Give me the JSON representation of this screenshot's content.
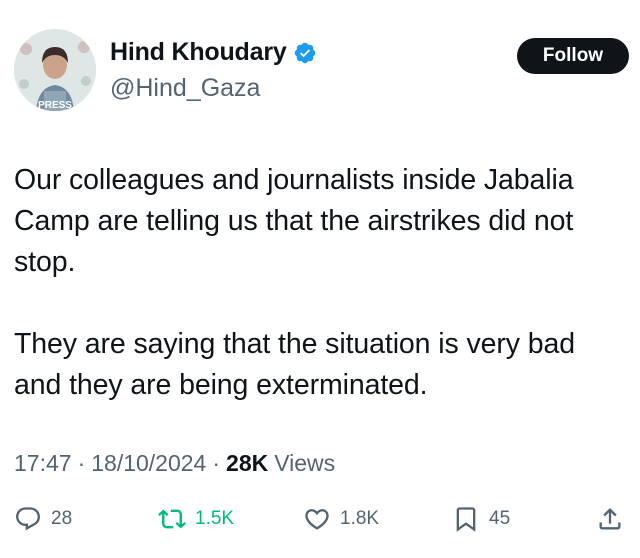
{
  "author": {
    "display_name": "Hind Khoudary",
    "handle": "@Hind_Gaza",
    "verified": true,
    "avatar_text": "PRESS"
  },
  "follow_label": "Follow",
  "tweet": {
    "paragraphs": [
      "Our colleagues and journalists inside Jabalia Camp are telling us that the airstrikes did not stop.",
      "They are saying that the situation is very bad and they are being exterminated."
    ]
  },
  "meta": {
    "time": "17:47",
    "date": "18/10/2024",
    "views_count": "28K",
    "views_label": "Views",
    "separator": "·"
  },
  "actions": {
    "replies": "28",
    "retweets": "1.5K",
    "likes": "1.8K",
    "bookmarks": "45"
  },
  "colors": {
    "verified": "#1d9bf0",
    "retweet_active": "#00ba7c",
    "muted": "#536471",
    "text": "#0f1419"
  },
  "icons": [
    "verified-badge-icon",
    "reply-icon",
    "retweet-icon",
    "like-icon",
    "bookmark-icon",
    "share-icon"
  ]
}
